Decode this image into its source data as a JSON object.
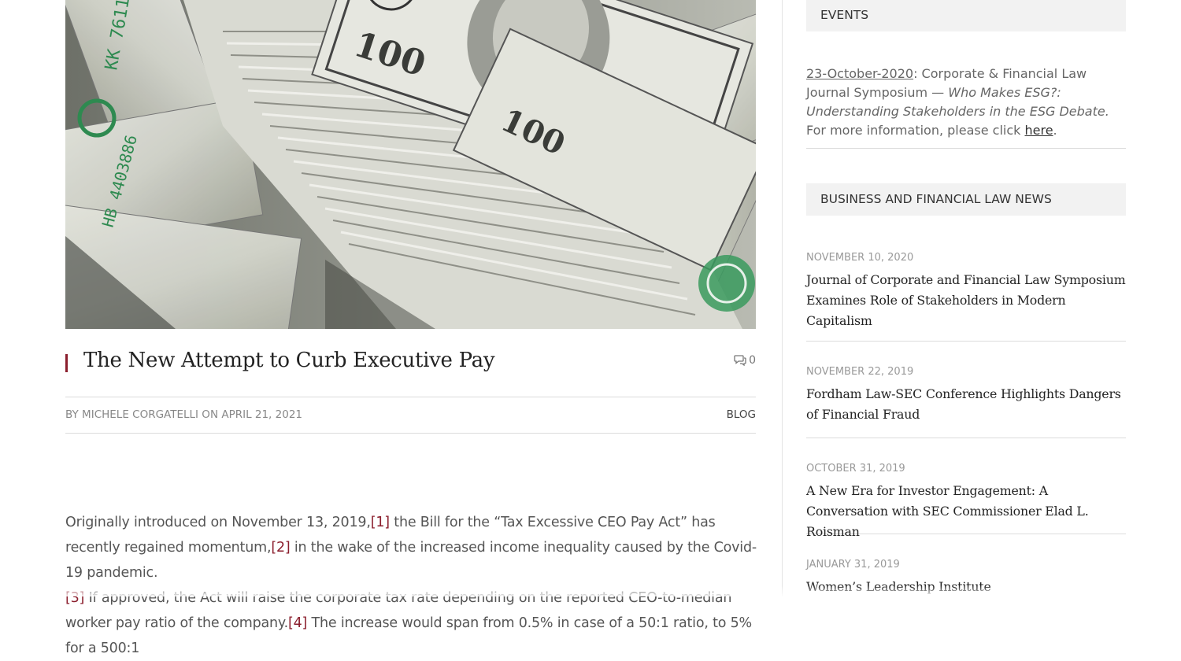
{
  "post": {
    "title": "The New Attempt to Curb Executive Pay",
    "comment_count": "0",
    "byline": "BY MICHELE CORGATELLI ON APRIL 21, 2021",
    "category": "BLOG",
    "paragraph": {
      "p1": "Originally introduced on November 13, 2019,",
      "fn1": "[1]",
      "p2": " the Bill for the “Tax Excessive CEO Pay Act” has recently regained momentum,",
      "fn2": "[2]",
      "p3": " in the wake of the increased income inequality caused by the Covid-19 pandemic.",
      "fn3": "[3]",
      "p4": " If approved, the Act will raise the corporate tax rate depending on the reported CEO-to-median worker pay ratio of the company.",
      "fn4": "[4]",
      "p5": " The increase would span from 0.5% in case of a 50:1 ratio, to 5% for a 500:1"
    }
  },
  "sidebar": {
    "events": {
      "heading": "EVENTS",
      "date_link": "23-October-2020",
      "text1": ": Corporate & Financial Law Journal Symposium — ",
      "title_italic": "Who Makes ESG?:  Understanding Stakeholders in the ESG Debate.",
      "text2": "  For more information, please click ",
      "here_link": "here",
      "text3": "."
    },
    "news": {
      "heading": "BUSINESS AND FINANCIAL LAW NEWS",
      "items": [
        {
          "date": "NOVEMBER 10, 2020",
          "title": "Journal of Corporate and Financial Law Symposium Examines Role of Stakeholders in Modern Capitalism"
        },
        {
          "date": "NOVEMBER 22, 2019",
          "title": "Fordham Law-SEC Conference Highlights Dangers of Financial Fraud"
        },
        {
          "date": "OCTOBER 31, 2019",
          "title": "A New Era for Investor Engagement: A Conversation with SEC Commissioner Elad L. Roisman"
        },
        {
          "date": "JANUARY 31, 2019",
          "title": "Women’s Leadership Institute"
        }
      ]
    }
  },
  "colors": {
    "accent": "#8b1e2d",
    "widget_bg": "#f2f2f2",
    "divider": "#dcdcdc"
  }
}
